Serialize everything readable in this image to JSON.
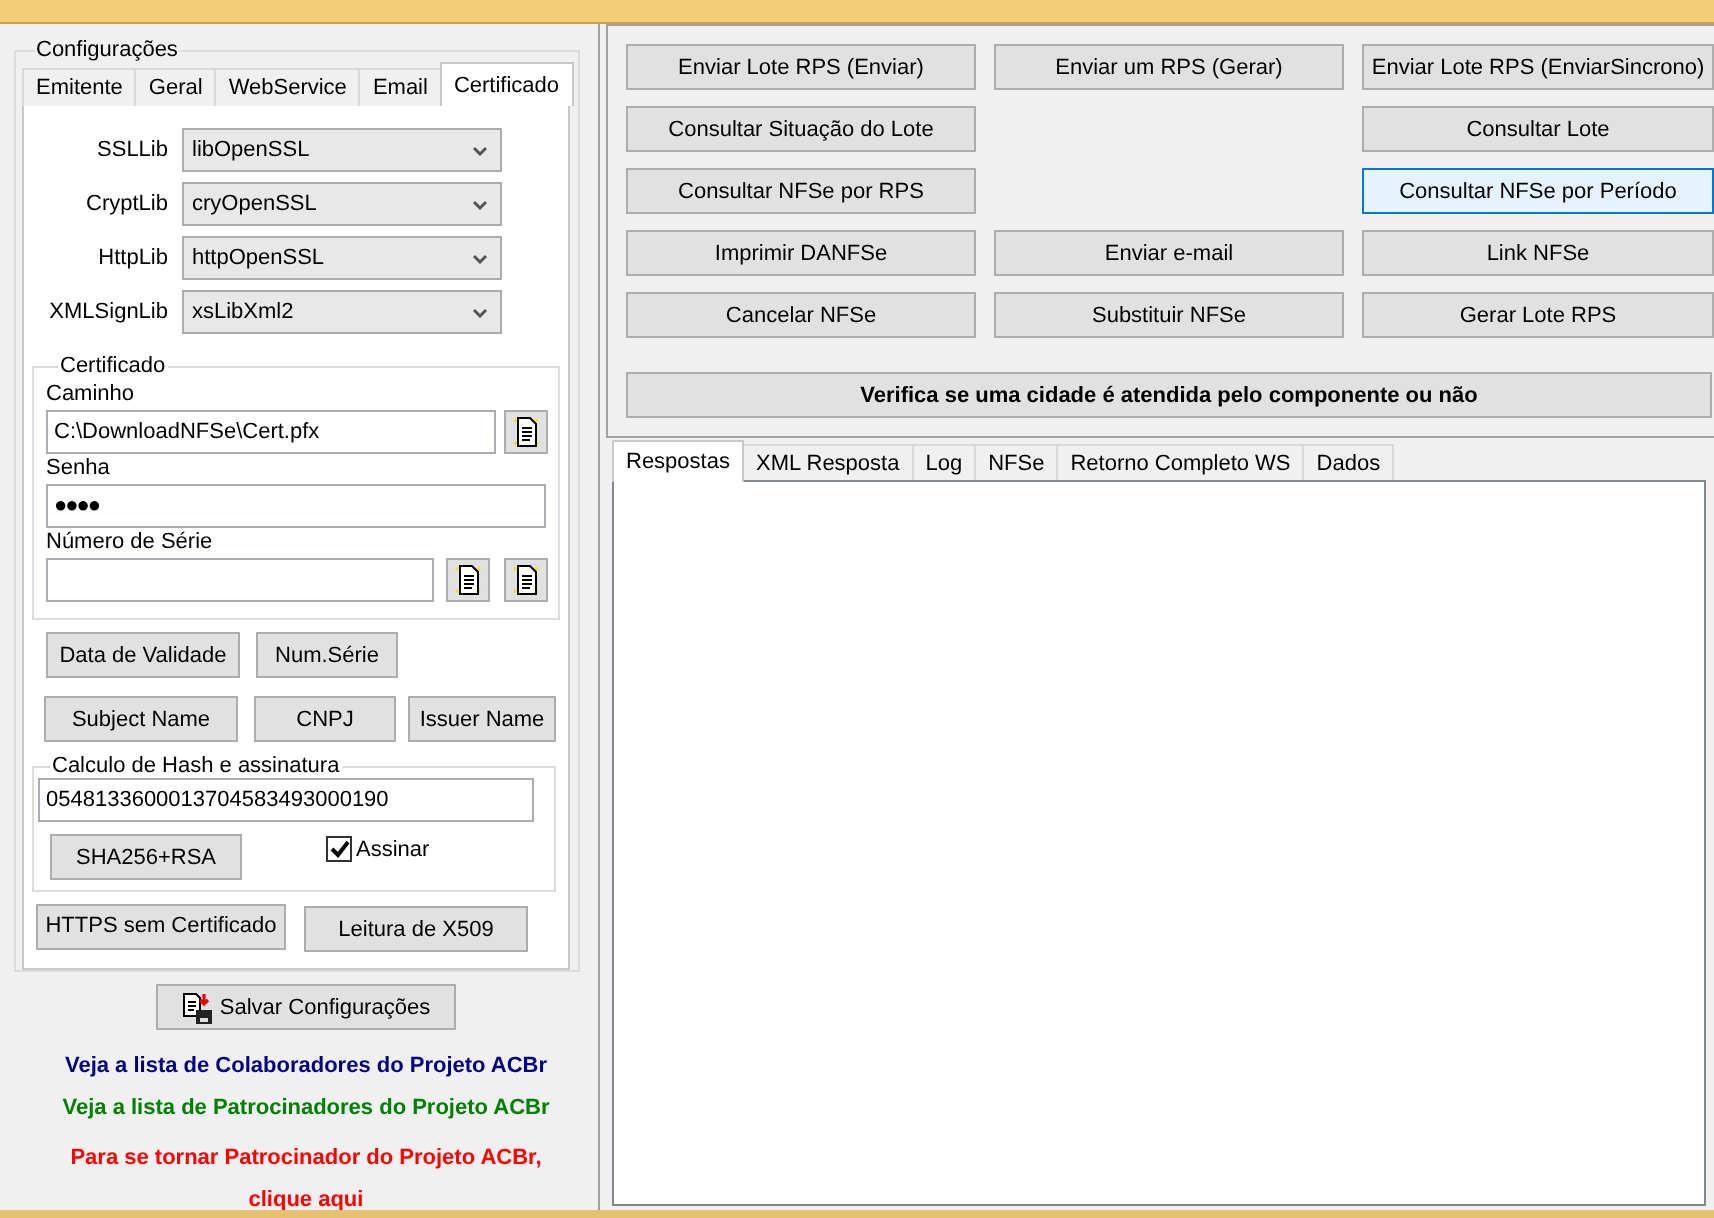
{
  "config": {
    "title": "Configurações",
    "tabs": [
      {
        "label": "Emitente",
        "selected": false
      },
      {
        "label": "Geral",
        "selected": false
      },
      {
        "label": "WebService",
        "selected": false
      },
      {
        "label": "Email",
        "selected": false
      },
      {
        "label": "Certificado",
        "selected": true
      }
    ],
    "libs": [
      {
        "label": "SSLLib",
        "value": "libOpenSSL"
      },
      {
        "label": "CryptLib",
        "value": "cryOpenSSL"
      },
      {
        "label": "HttpLib",
        "value": "httpOpenSSL"
      },
      {
        "label": "XMLSignLib",
        "value": "xsLibXml2"
      }
    ],
    "certificate": {
      "title": "Certificado",
      "path_label": "Caminho",
      "path": "C:\\DownloadNFSe\\Cert.pfx",
      "password_label": "Senha",
      "password": "●●●●",
      "serial_label": "Número de Série"
    },
    "cert_buttons": [
      [
        "Data de Validade",
        "Num.Série"
      ],
      [
        "Subject Name",
        "CNPJ",
        "Issuer Name"
      ]
    ],
    "hash": {
      "title": "Calculo de Hash e assinatura",
      "value": "0548133600013704583493000190",
      "button": "SHA256+RSA",
      "sign": {
        "label": "Assinar",
        "checked": true
      }
    },
    "bottom_buttons": [
      "HTTPS sem Certificado",
      "Leitura de X509"
    ]
  },
  "save_button": "Salvar Configurações",
  "links": [
    {
      "lines": [
        "Veja a lista de Colaboradores do Projeto ACBr"
      ],
      "color": "#000080"
    },
    {
      "lines": [
        "Veja a lista de Patrocinadores do Projeto ACBr"
      ],
      "color": "#008000"
    },
    {
      "lines": [
        "Para se tornar Patrocinador do Projeto ACBr,",
        "clique aqui"
      ],
      "color": "#ff0000"
    }
  ],
  "actions": [
    [
      {
        "kind": "button",
        "label": "Enviar Lote RPS (Enviar)",
        "focused": false
      },
      {
        "kind": "button",
        "label": "Enviar um RPS (Gerar)",
        "focused": false
      },
      {
        "kind": "button",
        "label": "Enviar Lote RPS (EnviarSincrono)",
        "focused": false
      }
    ],
    [
      {
        "kind": "button",
        "label": "Consultar Situação do Lote",
        "focused": false
      },
      {
        "kind": "gap"
      },
      {
        "kind": "button",
        "label": "Consultar Lote",
        "focused": false
      }
    ],
    [
      {
        "kind": "button",
        "label": "Consultar NFSe por RPS",
        "focused": false
      },
      {
        "kind": "gap"
      },
      {
        "kind": "button",
        "label": "Consultar NFSe por Período",
        "focused": true
      }
    ],
    [
      {
        "kind": "button",
        "label": "Imprimir DANFSe",
        "focused": false
      },
      {
        "kind": "button",
        "label": "Enviar e-mail",
        "focused": false
      },
      {
        "kind": "button",
        "label": "Link NFSe",
        "focused": false
      }
    ],
    [
      {
        "kind": "button",
        "label": "Cancelar NFSe",
        "focused": false
      },
      {
        "kind": "button",
        "label": "Substituir NFSe",
        "focused": false
      },
      {
        "kind": "button",
        "label": "Gerar Lote RPS",
        "focused": false
      }
    ]
  ],
  "check_city_button": "Verifica se uma cidade é atendida pelo componente ou não",
  "response_tabs": [
    {
      "label": "Respostas",
      "selected": true
    },
    {
      "label": "XML Resposta",
      "selected": false
    },
    {
      "label": "Log",
      "selected": false
    },
    {
      "label": "NFSe",
      "selected": false
    },
    {
      "label": "Retorno Completo WS",
      "selected": false
    },
    {
      "label": "Dados",
      "selected": false
    }
  ]
}
